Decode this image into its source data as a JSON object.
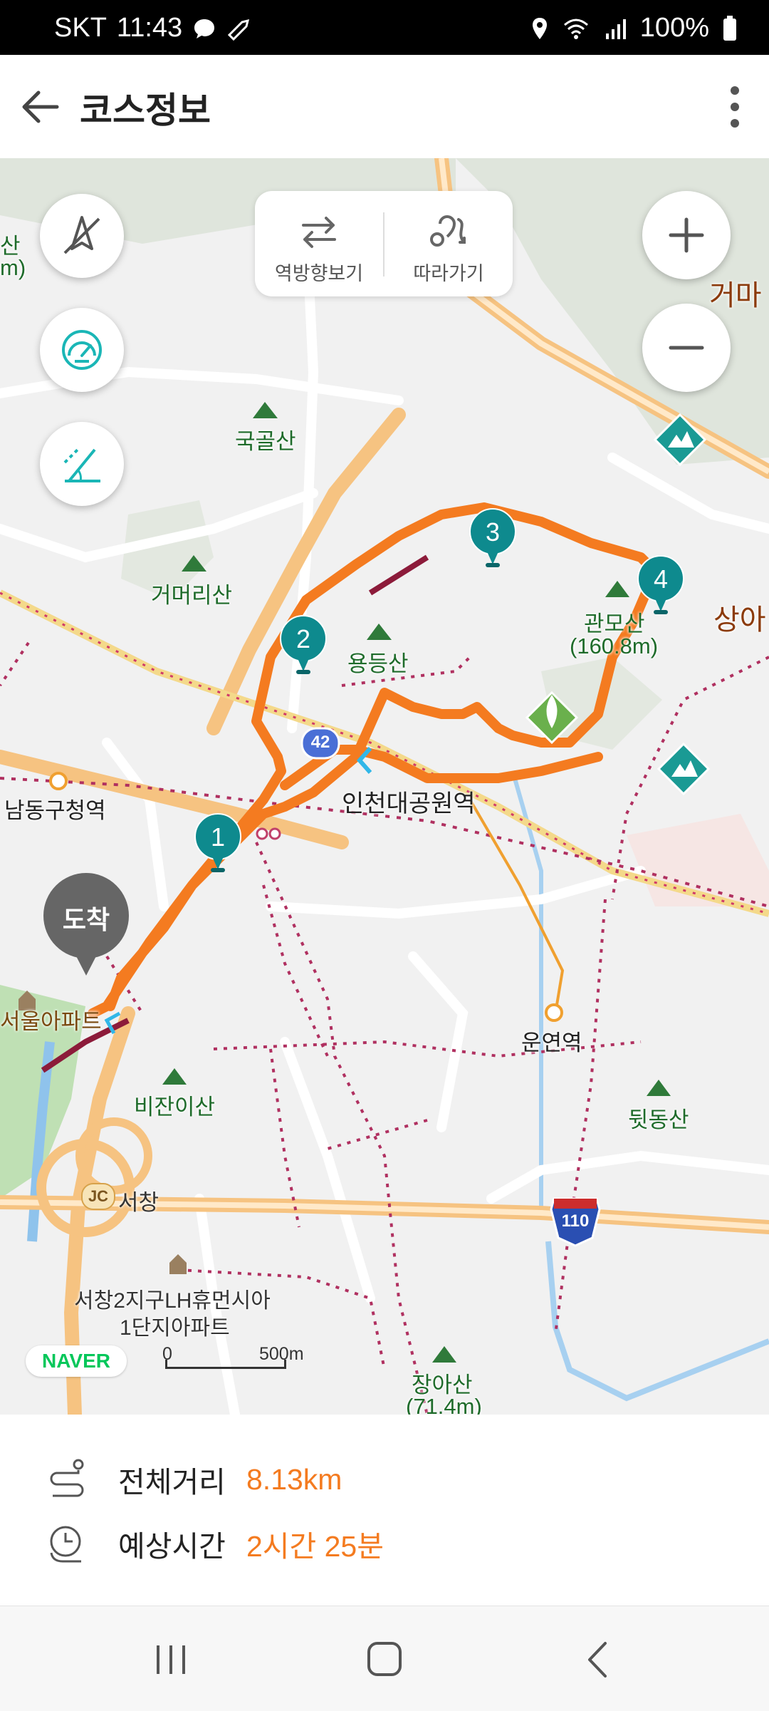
{
  "status_bar": {
    "carrier": "SKT",
    "time": "11:43",
    "battery": "100%",
    "icons": [
      "chat-bubble-icon",
      "shoe-icon",
      "location-icon",
      "wifi-icon",
      "signal-icon",
      "battery-icon"
    ]
  },
  "app_bar": {
    "title": "코스정보",
    "back_icon": "arrow-left-icon",
    "more_icon": "more-vertical-icon"
  },
  "map": {
    "tools": {
      "reverse_label": "역방향보기",
      "follow_label": "따라가기"
    },
    "labels": {
      "gukgol": "국골산",
      "geomeori": "거머리산",
      "yongdeung": "용등산",
      "gwanmo": "관모산",
      "gwanmo_elev": "(160.8m)",
      "sanga": "상아",
      "geoma": "거마",
      "namdong_station": "남동구청역",
      "incheon_park_station": "인천대공원역",
      "unyeon_station": "운연역",
      "apt_left": "서울아파트",
      "bijani": "비잔이산",
      "dwitdong": "뒷동산",
      "seochang_jc": "서창",
      "jc_badge": "JC",
      "seochang_apt1": "서창2지구LH휴먼시아",
      "seochang_apt2": "1단지아파트",
      "janga": "장아산",
      "janga_elev": "(71.4m)",
      "left_san": "산",
      "left_m": "m)",
      "road_42": "42",
      "road_110": "110"
    },
    "waypoints": [
      "1",
      "2",
      "3",
      "4"
    ],
    "arrival_label": "도착",
    "provider": "NAVER",
    "scale": {
      "zero": "0",
      "distance": "500m"
    },
    "colors": {
      "route": "#f47b20",
      "waypoint": "#0e8a8e",
      "accent": "#f47b20"
    }
  },
  "course_info": {
    "distance_label": "전체거리",
    "distance_value": "8.13km",
    "time_label": "예상시간",
    "time_value": "2시간 25분"
  },
  "nav_bar": {
    "icons": [
      "recent-apps-icon",
      "home-icon",
      "back-icon"
    ]
  }
}
